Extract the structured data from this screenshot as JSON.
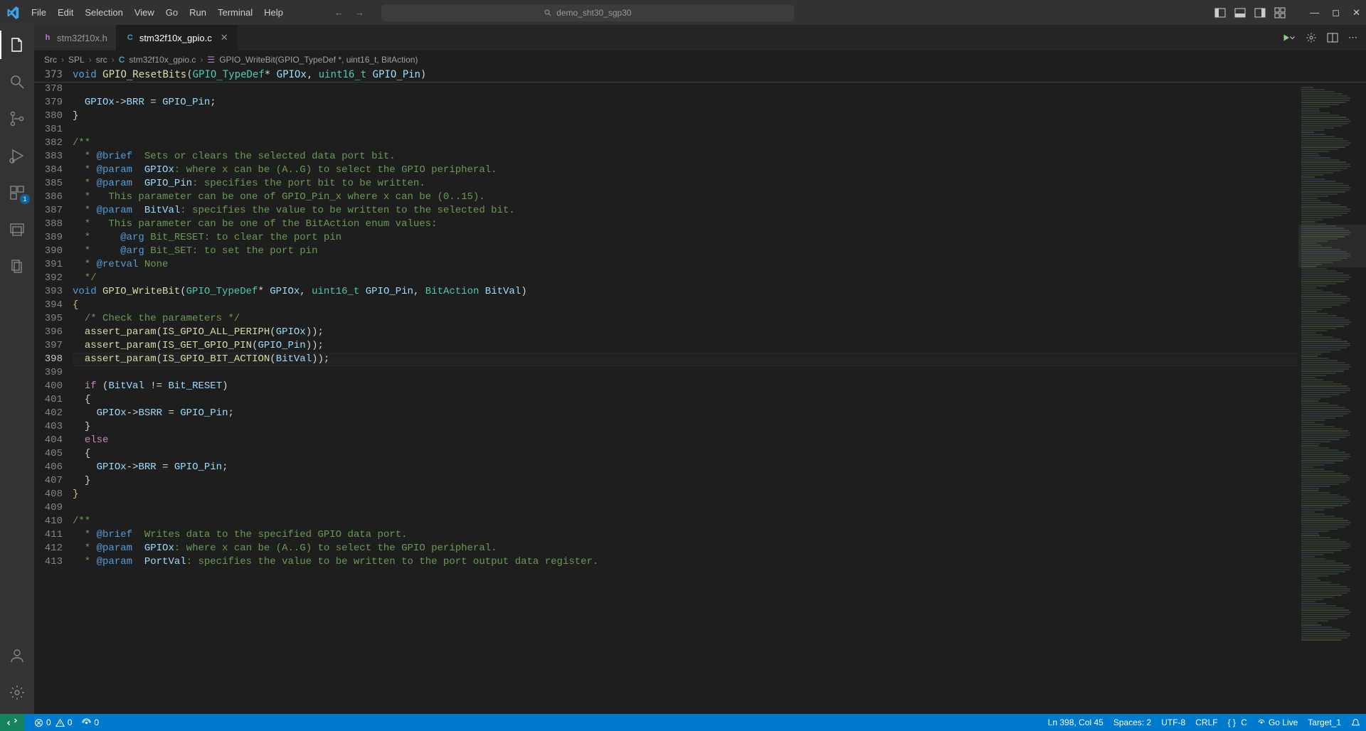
{
  "menu": [
    "File",
    "Edit",
    "Selection",
    "View",
    "Go",
    "Run",
    "Terminal",
    "Help"
  ],
  "search_placeholder": "demo_sht30_sgp30",
  "tabs": [
    {
      "icon": "h",
      "icon_color": "#b180d7",
      "label": "stm32f10x.h",
      "active": false
    },
    {
      "icon": "C",
      "icon_color": "#519aba",
      "label": "stm32f10x_gpio.c",
      "active": true
    }
  ],
  "breadcrumb": {
    "parts": [
      "Src",
      "SPL",
      "src"
    ],
    "file_icon": "C",
    "file": "stm32f10x_gpio.c",
    "symbol": "GPIO_WriteBit(GPIO_TypeDef *, uint16_t, BitAction)"
  },
  "sticky": {
    "num": "373",
    "html": "<span class='kw'>void</span> <span class='fn'>GPIO_ResetBits</span><span class='punct'>(</span><span class='type'>GPIO_TypeDef</span><span class='punct'>*</span> <span class='param'>GPIOx</span><span class='punct'>,</span> <span class='type'>uint16_t</span> <span class='param'>GPIO_Pin</span><span class='punct'>)</span>"
  },
  "lines": [
    {
      "n": "378",
      "html": ""
    },
    {
      "n": "379",
      "html": "  <span class='param'>GPIOx</span><span class='punct'>-></span><span class='param'>BRR</span> <span class='punct'>=</span> <span class='param'>GPIO_Pin</span><span class='punct'>;</span>"
    },
    {
      "n": "380",
      "html": "<span class='punct'>}</span>"
    },
    {
      "n": "381",
      "html": ""
    },
    {
      "n": "382",
      "html": "<span class='cm'>/**</span>"
    },
    {
      "n": "383",
      "html": "<span class='cm'>  * </span><span class='doctag'>@brief</span><span class='cm'>  Sets or clears the selected data port bit.</span>"
    },
    {
      "n": "384",
      "html": "<span class='cm'>  * </span><span class='doctag'>@param</span><span class='cm'>  </span><span class='docparam'>GPIOx</span><span class='cm'>: where x can be (A..G) to select the GPIO peripheral.</span>"
    },
    {
      "n": "385",
      "html": "<span class='cm'>  * </span><span class='doctag'>@param</span><span class='cm'>  </span><span class='docparam'>GPIO_Pin</span><span class='cm'>: specifies the port bit to be written.</span>"
    },
    {
      "n": "386",
      "html": "<span class='cm'>  *   This parameter can be one of GPIO_Pin_x where x can be (0..15).</span>"
    },
    {
      "n": "387",
      "html": "<span class='cm'>  * </span><span class='doctag'>@param</span><span class='cm'>  </span><span class='docparam'>BitVal</span><span class='cm'>: specifies the value to be written to the selected bit.</span>"
    },
    {
      "n": "388",
      "html": "<span class='cm'>  *   This parameter can be one of the BitAction enum values:</span>"
    },
    {
      "n": "389",
      "html": "<span class='cm'>  *     </span><span class='doctag'>@arg</span><span class='cm'> Bit_RESET: to clear the port pin</span>"
    },
    {
      "n": "390",
      "html": "<span class='cm'>  *     </span><span class='doctag'>@arg</span><span class='cm'> Bit_SET: to set the port pin</span>"
    },
    {
      "n": "391",
      "html": "<span class='cm'>  * </span><span class='doctag'>@retval</span><span class='cm'> None</span>"
    },
    {
      "n": "392",
      "html": "<span class='cm'>  */</span>"
    },
    {
      "n": "393",
      "html": "<span class='kw'>void</span> <span class='fn'>GPIO_WriteBit</span><span class='punct'>(</span><span class='type'>GPIO_TypeDef</span><span class='punct'>*</span> <span class='param'>GPIOx</span><span class='punct'>,</span> <span class='type'>uint16_t</span> <span class='param'>GPIO_Pin</span><span class='punct'>,</span> <span class='type'>BitAction</span> <span class='param'>BitVal</span><span class='punct'>)</span>"
    },
    {
      "n": "394",
      "html": "<span class='folded'>{</span>"
    },
    {
      "n": "395",
      "html": "  <span class='cm'>/* Check the parameters */</span>"
    },
    {
      "n": "396",
      "html": "  <span class='fn'>assert_param</span><span class='punct'>(</span><span class='fn'>IS_GPIO_ALL_PERIPH</span><span class='punct'>(</span><span class='param'>GPIOx</span><span class='punct'>));</span>"
    },
    {
      "n": "397",
      "html": "  <span class='fn'>assert_param</span><span class='punct'>(</span><span class='fn'>IS_GET_GPIO_PIN</span><span class='punct'>(</span><span class='param'>GPIO_Pin</span><span class='punct'>));</span>"
    },
    {
      "n": "398",
      "html": "  <span class='fn'>assert_param</span><span class='punct'>(</span><span class='fn'>IS_GPIO_BIT_ACTION</span><span class='punct'>(</span><span class='param'>BitVal</span><span class='punct'>));</span>",
      "current": true
    },
    {
      "n": "399",
      "html": "  "
    },
    {
      "n": "400",
      "html": "  <span class='macro'>if</span> <span class='punct'>(</span><span class='param'>BitVal</span> <span class='punct'>!=</span> <span class='param'>Bit_RESET</span><span class='punct'>)</span>"
    },
    {
      "n": "401",
      "html": "  <span class='punct'>{</span>"
    },
    {
      "n": "402",
      "html": "    <span class='param'>GPIOx</span><span class='punct'>-></span><span class='param'>BSRR</span> <span class='punct'>=</span> <span class='param'>GPIO_Pin</span><span class='punct'>;</span>"
    },
    {
      "n": "403",
      "html": "  <span class='punct'>}</span>"
    },
    {
      "n": "404",
      "html": "  <span class='macro'>else</span>"
    },
    {
      "n": "405",
      "html": "  <span class='punct'>{</span>"
    },
    {
      "n": "406",
      "html": "    <span class='param'>GPIOx</span><span class='punct'>-></span><span class='param'>BRR</span> <span class='punct'>=</span> <span class='param'>GPIO_Pin</span><span class='punct'>;</span>"
    },
    {
      "n": "407",
      "html": "  <span class='punct'>}</span>"
    },
    {
      "n": "408",
      "html": "<span class='folded'>}</span>"
    },
    {
      "n": "409",
      "html": ""
    },
    {
      "n": "410",
      "html": "<span class='cm'>/**</span>"
    },
    {
      "n": "411",
      "html": "<span class='cm'>  * </span><span class='doctag'>@brief</span><span class='cm'>  Writes data to the specified GPIO data port.</span>"
    },
    {
      "n": "412",
      "html": "<span class='cm'>  * </span><span class='doctag'>@param</span><span class='cm'>  </span><span class='docparam'>GPIOx</span><span class='cm'>: where x can be (A..G) to select the GPIO peripheral.</span>"
    },
    {
      "n": "413",
      "html": "<span class='cm'>  * </span><span class='doctag'>@param</span><span class='cm'>  </span><span class='docparam'>PortVal</span><span class='cm'>: specifies the value to be written to the port output data register.</span>"
    }
  ],
  "activity_badge": "1",
  "status": {
    "errors": "0",
    "warnings": "0",
    "port": "0",
    "cursor": "Ln 398, Col 45",
    "spaces": "Spaces: 2",
    "encoding": "UTF-8",
    "eol": "CRLF",
    "lang": "C",
    "golive": "Go Live",
    "target": "Target_1"
  }
}
